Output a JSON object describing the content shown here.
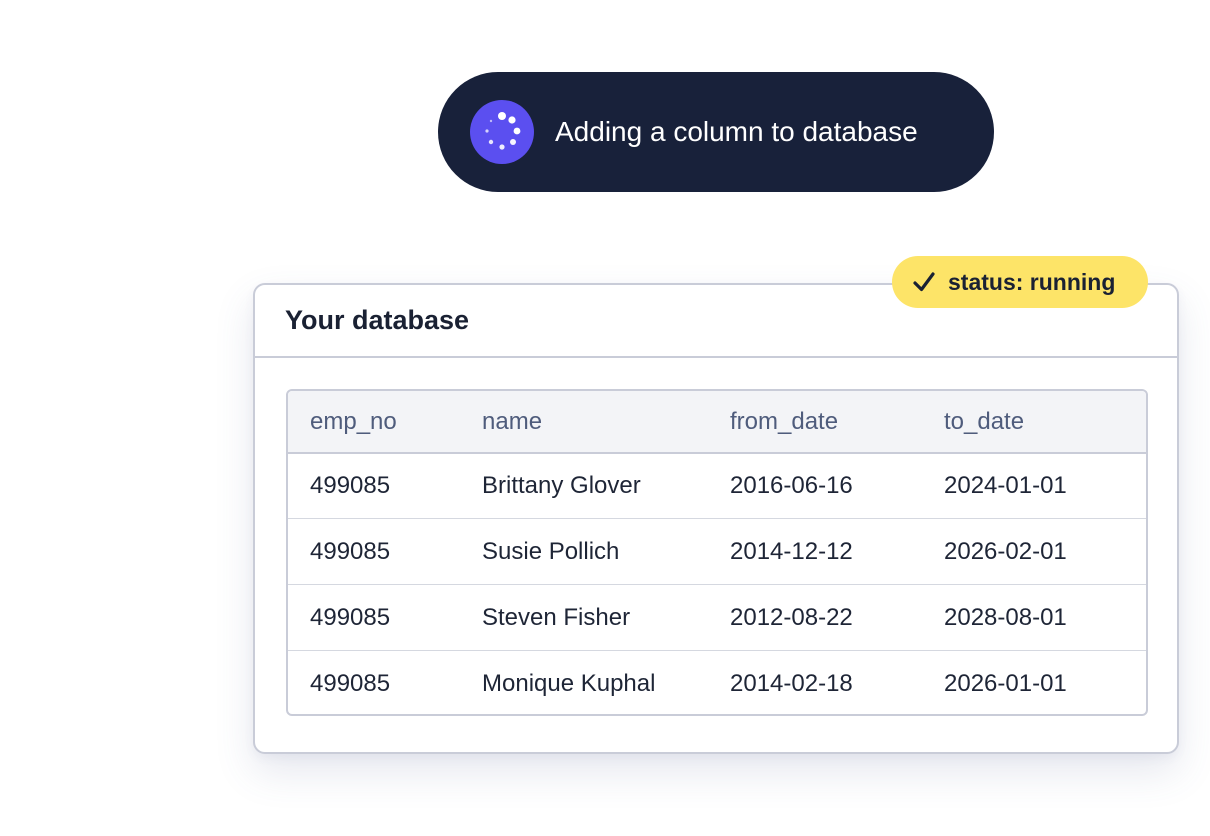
{
  "toast": {
    "icon": "loading-spinner-icon",
    "message": "Adding a column to database"
  },
  "status_badge": {
    "icon": "checkmark-icon",
    "label": "status: running"
  },
  "card": {
    "title": "Your database"
  },
  "table": {
    "columns": [
      "emp_no",
      "name",
      "from_date",
      "to_date"
    ],
    "rows": [
      [
        "499085",
        "Brittany Glover",
        "2016-06-16",
        "2024-01-01"
      ],
      [
        "499085",
        "Susie Pollich",
        "2014-12-12",
        "2026-02-01"
      ],
      [
        "499085",
        "Steven Fisher",
        "2012-08-22",
        "2028-08-01"
      ],
      [
        "499085",
        "Monique Kuphal",
        "2014-02-18",
        "2026-01-01"
      ]
    ]
  },
  "colors": {
    "toast_background": "#18213a",
    "spinner_background": "#5b4ff0",
    "badge_background": "#fde468",
    "header_background": "#f3f4f7",
    "border": "#c9ccd8"
  }
}
